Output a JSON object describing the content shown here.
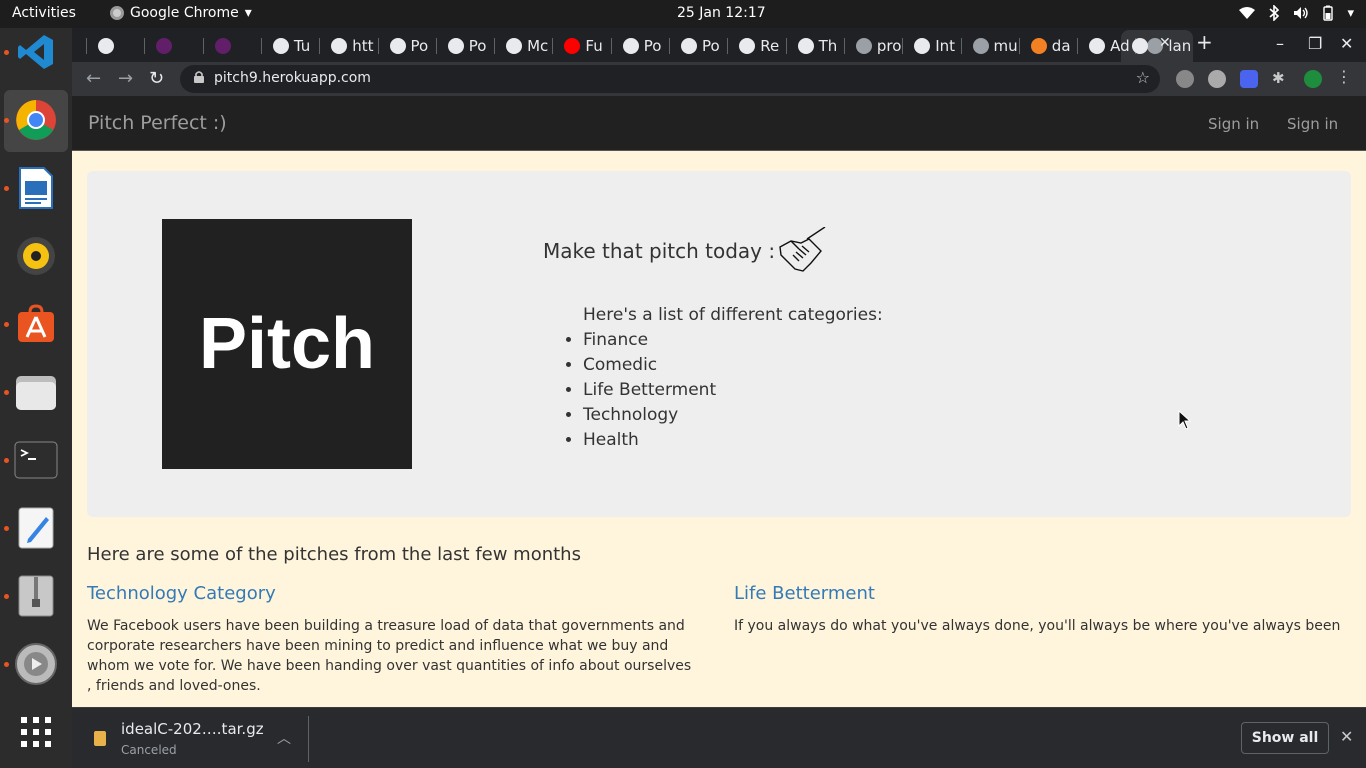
{
  "topbar": {
    "activities": "Activities",
    "app_name": "Google Chrome",
    "datetime": "25 Jan  12:17"
  },
  "dock": {
    "items": [
      "vscode-icon",
      "chrome-icon",
      "libreoffice-writer-icon",
      "rhythmbox-icon",
      "ubuntu-software-icon",
      "files-icon",
      "terminal-icon",
      "text-editor-icon",
      "archive-manager-icon",
      "settings-icon",
      "app-grid-icon"
    ]
  },
  "browser": {
    "tabs": [
      {
        "title": "",
        "icon": "tab-favicon"
      },
      {
        "title": "",
        "icon": "slack-icon"
      },
      {
        "title": "",
        "icon": "slack-icon"
      },
      {
        "title": "Tu",
        "icon": "tab-favicon"
      },
      {
        "title": "htt",
        "icon": "globe-icon"
      },
      {
        "title": "Po",
        "icon": "tab-favicon"
      },
      {
        "title": "Po",
        "icon": "tab-favicon"
      },
      {
        "title": "Mc",
        "icon": "globe-icon"
      },
      {
        "title": "Fu",
        "icon": "youtube-icon"
      },
      {
        "title": "Po",
        "icon": "tab-favicon"
      },
      {
        "title": "Po",
        "icon": "tab-favicon"
      },
      {
        "title": "Re",
        "icon": "tab-favicon"
      },
      {
        "title": "Th",
        "icon": "tab-favicon"
      },
      {
        "title": "pro",
        "icon": "github-icon"
      },
      {
        "title": "Int",
        "icon": "tab-favicon"
      },
      {
        "title": "mu",
        "icon": "github-icon"
      },
      {
        "title": "da",
        "icon": "stackoverflow-icon"
      },
      {
        "title": "Ad",
        "icon": "globe-icon"
      },
      {
        "title": "lan",
        "icon": "github-icon"
      },
      {
        "title": "",
        "icon": "globe-icon"
      }
    ],
    "new_tab": "+",
    "url": "pitch9.herokuapp.com"
  },
  "page": {
    "brand": "Pitch Perfect :)",
    "nav_signin_1": "Sign in",
    "nav_signin_2": "Sign in",
    "logo_text": "Pitch",
    "tagline": "Make that pitch today :",
    "categories_intro": "Here's a list of different categories:",
    "categories": [
      "Finance",
      "Comedic",
      "Life Betterment",
      "Technology",
      "Health"
    ],
    "recent_heading": "Here are some of the pitches from the last few months",
    "pitches": [
      {
        "title": "Technology Category",
        "body": "We Facebook users have been building a treasure load of data that governments and corporate researchers have been mining to predict and influence what we buy and whom we vote for. We have been handing over vast quantities of info about ourselves , friends and loved-ones."
      },
      {
        "title": "Life Betterment",
        "body": "If you always do what you've always done, you'll always be where you've always been"
      }
    ],
    "link_color": "#337ab7"
  },
  "downloads": {
    "filename": "idealC-202….tar.gz",
    "status": "Canceled",
    "show_all": "Show all"
  }
}
